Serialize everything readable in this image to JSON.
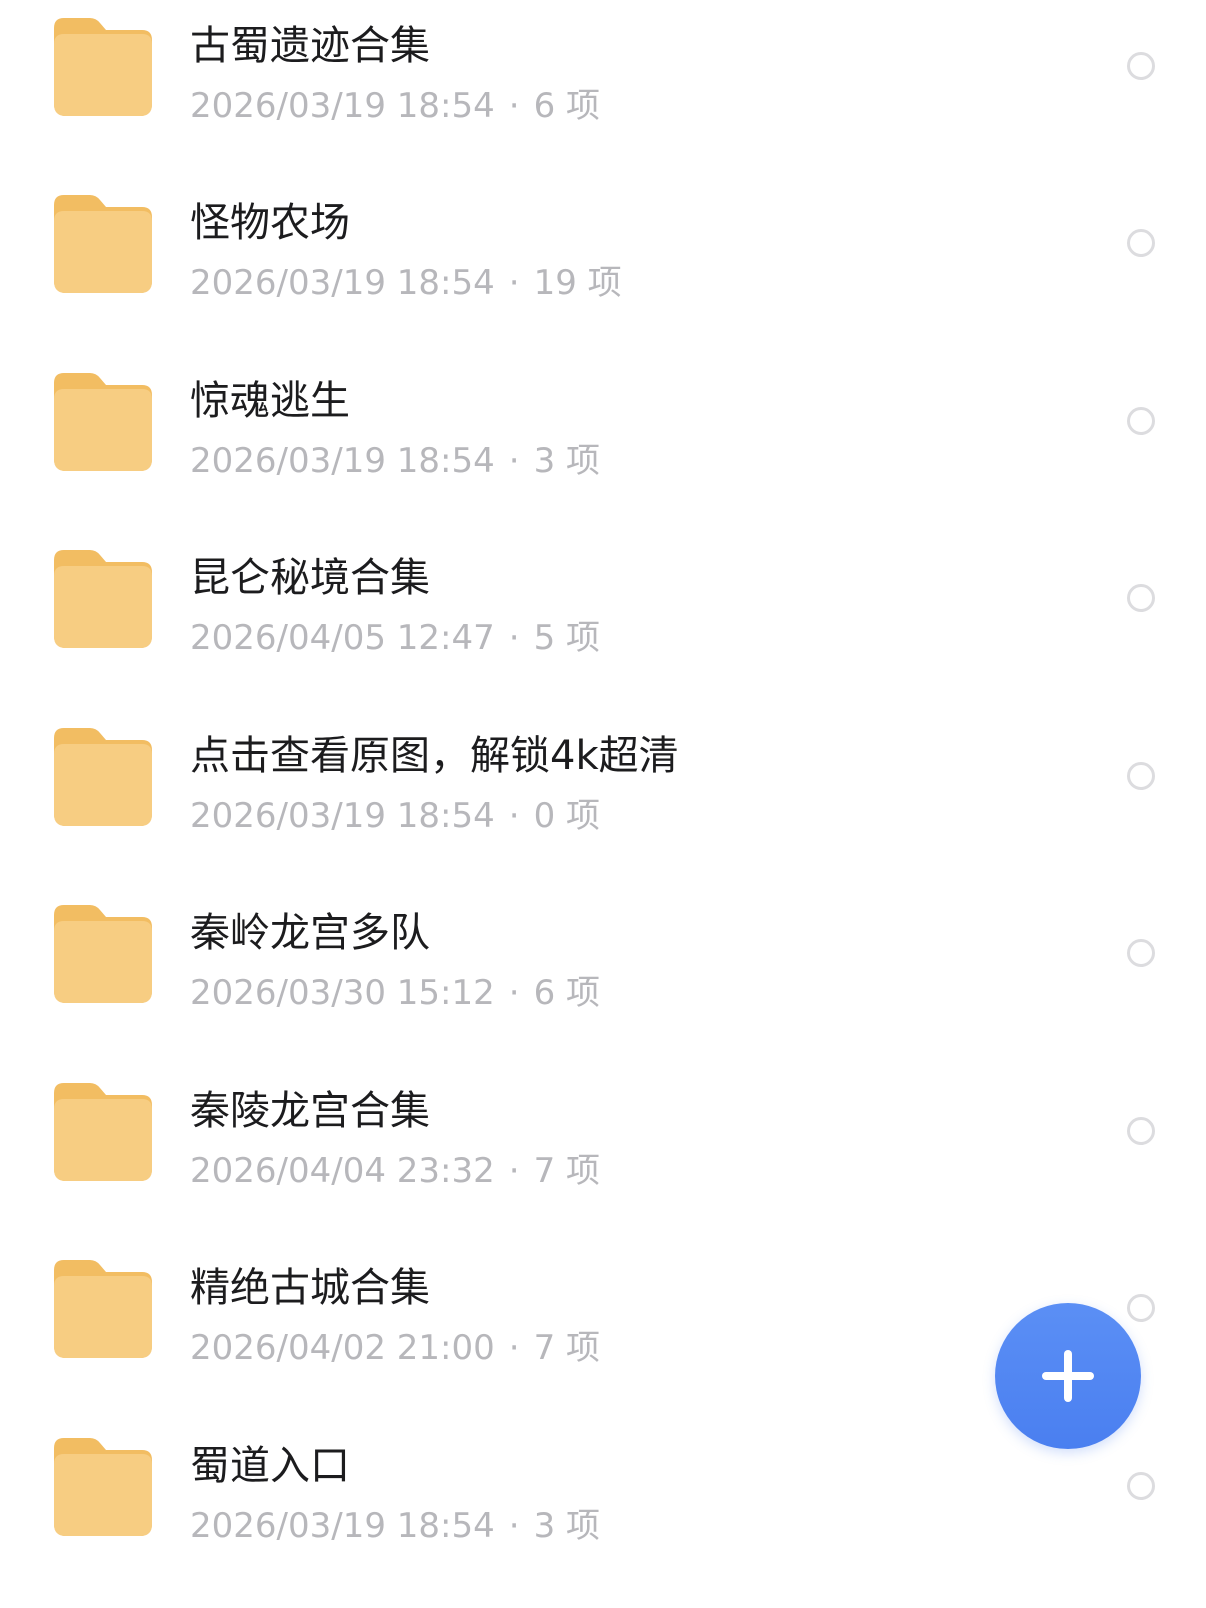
{
  "folders": [
    {
      "name": "古蜀遗迹合集",
      "date": "2026/03/19 18:54",
      "count": "6 项"
    },
    {
      "name": "怪物农场",
      "date": "2026/03/19 18:54",
      "count": "19 项"
    },
    {
      "name": "惊魂逃生",
      "date": "2026/03/19 18:54",
      "count": "3 项"
    },
    {
      "name": "昆仑秘境合集",
      "date": "2026/04/05 12:47",
      "count": "5 项"
    },
    {
      "name": "点击查看原图，解锁4k超清",
      "date": "2026/03/19 18:54",
      "count": "0 项"
    },
    {
      "name": "秦岭龙宫多队",
      "date": "2026/03/30 15:12",
      "count": "6 项"
    },
    {
      "name": "秦陵龙宫合集",
      "date": "2026/04/04 23:32",
      "count": "7 项"
    },
    {
      "name": "精绝古城合集",
      "date": "2026/04/02 21:00",
      "count": "7 项"
    },
    {
      "name": "蜀道入口",
      "date": "2026/03/19 18:54",
      "count": "3 项"
    }
  ],
  "separator": "·",
  "icons": {
    "folder": "folder-icon",
    "select": "radio-circle",
    "fab": "plus-icon"
  },
  "colors": {
    "folder_top": "#F8D18A",
    "folder_bottom": "#F2BE63",
    "fab": "#4F83F2",
    "meta_text": "#B7B7BB"
  }
}
